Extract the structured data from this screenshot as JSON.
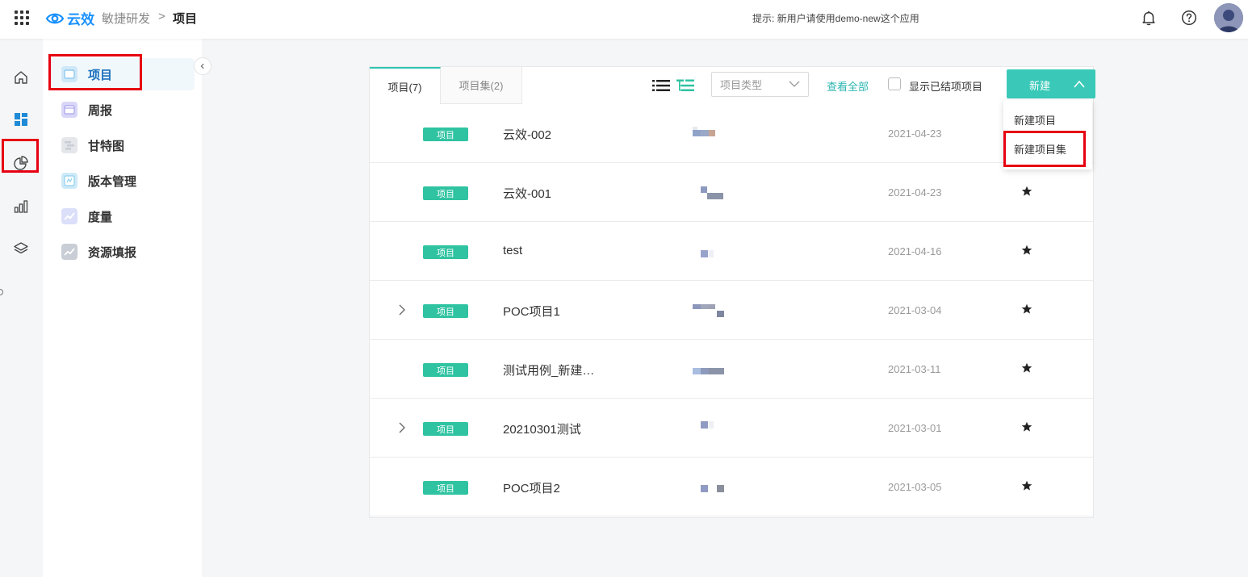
{
  "header": {
    "brand": "云效",
    "app_name": "敏捷研发",
    "separator": ">",
    "current": "项目",
    "hint": "提示: 新用户请使用demo-new这个应用"
  },
  "rail": {
    "items": [
      "home-icon",
      "dashboard-icon",
      "pie-chart-icon",
      "bar-chart-icon",
      "layers-icon"
    ]
  },
  "subnav": {
    "items": [
      {
        "label": "项目",
        "color": "#7ec3ee"
      },
      {
        "label": "周报",
        "color": "#a9a4ee"
      },
      {
        "label": "甘特图",
        "color": "#c8ccd4"
      },
      {
        "label": "版本管理",
        "color": "#8fd0ef"
      },
      {
        "label": "度量",
        "color": "#aeb4f2"
      },
      {
        "label": "资源填报",
        "color": "#b7bcc6"
      }
    ]
  },
  "tabs": [
    {
      "label": "项目(7)"
    },
    {
      "label": "项目集(2)"
    }
  ],
  "toolbar": {
    "type_placeholder": "项目类型",
    "view_all": "查看全部",
    "show_closed": "显示已结项项目",
    "new_label": "新建"
  },
  "dropdown": {
    "items": [
      "新建项目",
      "新建项目集"
    ]
  },
  "projects": [
    {
      "tag": "项目",
      "name": "云效-002",
      "date": "2021-04-23",
      "expandable": false,
      "starred": false
    },
    {
      "tag": "项目",
      "name": "云效-001",
      "date": "2021-04-23",
      "expandable": false,
      "starred": true
    },
    {
      "tag": "项目",
      "name": "test",
      "date": "2021-04-16",
      "expandable": false,
      "starred": true
    },
    {
      "tag": "项目",
      "name": "POC项目1",
      "date": "2021-03-04",
      "expandable": true,
      "starred": true
    },
    {
      "tag": "项目",
      "name": "测试用例_新建…",
      "date": "2021-03-11",
      "expandable": false,
      "starred": true
    },
    {
      "tag": "项目",
      "name": "20210301测试",
      "date": "2021-03-01",
      "expandable": true,
      "starred": true
    },
    {
      "tag": "项目",
      "name": "POC项目2",
      "date": "2021-03-05",
      "expandable": false,
      "starred": true
    }
  ],
  "colors": {
    "accent": "#3ac9b8",
    "tag": "#2fc3a1",
    "brand": "#1890ff",
    "highlight": "#e60012"
  }
}
